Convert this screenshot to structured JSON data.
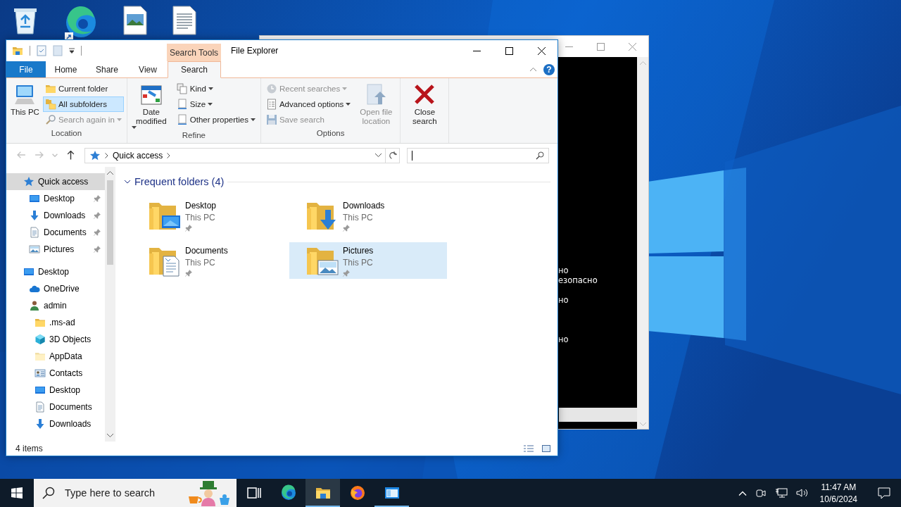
{
  "console_window": {
    "lines": [
      "но",
      "езопасно",
      "но",
      "но"
    ]
  },
  "explorer": {
    "title": "File Explorer",
    "contextual_tab_group": "Search Tools",
    "help_button": "?",
    "ribbon_tabs": [
      {
        "label": "File",
        "kind": "file",
        "selected": false
      },
      {
        "label": "Home",
        "kind": "tab",
        "selected": false
      },
      {
        "label": "Share",
        "kind": "tab",
        "selected": false
      },
      {
        "label": "View",
        "kind": "tab",
        "selected": false
      },
      {
        "label": "Search",
        "kind": "tab",
        "selected": true
      }
    ],
    "ribbon_groups": [
      {
        "label": "Location",
        "blocks": [
          {
            "kind": "large",
            "buttons": [
              {
                "label": "This PC",
                "kind": "pc",
                "selected": false,
                "disabled": false,
                "dropdown": false
              }
            ]
          },
          {
            "kind": "column",
            "buttons": [
              {
                "label": "Current folder",
                "kind": "folder",
                "selected": false,
                "disabled": false,
                "dropdown": false
              },
              {
                "label": "All subfolders",
                "kind": "subfolders",
                "selected": true,
                "disabled": false,
                "dropdown": false
              },
              {
                "label": "Search again in",
                "kind": "searchagain",
                "selected": false,
                "disabled": true,
                "dropdown": true
              }
            ]
          }
        ]
      },
      {
        "label": "Refine",
        "blocks": [
          {
            "kind": "large",
            "buttons": [
              {
                "label": "Date modified",
                "kind": "calendar",
                "selected": false,
                "disabled": false,
                "dropdown": true
              }
            ]
          },
          {
            "kind": "column",
            "buttons": [
              {
                "label": "Kind",
                "kind": "kind",
                "selected": false,
                "disabled": false,
                "dropdown": true
              },
              {
                "label": "Size",
                "kind": "size",
                "selected": false,
                "disabled": false,
                "dropdown": true
              },
              {
                "label": "Other properties",
                "kind": "properties",
                "selected": false,
                "disabled": false,
                "dropdown": true
              }
            ]
          }
        ]
      },
      {
        "label": "Options",
        "blocks": [
          {
            "kind": "column",
            "buttons": [
              {
                "label": "Recent searches",
                "kind": "recent",
                "selected": false,
                "disabled": true,
                "dropdown": true
              },
              {
                "label": "Advanced options",
                "kind": "advanced",
                "selected": false,
                "disabled": false,
                "dropdown": true
              },
              {
                "label": "Save search",
                "kind": "save",
                "selected": false,
                "disabled": true,
                "dropdown": false
              }
            ]
          },
          {
            "kind": "large",
            "buttons": [
              {
                "label": "Open file location",
                "kind": "openloc",
                "selected": false,
                "disabled": true,
                "dropdown": false
              }
            ]
          }
        ]
      },
      {
        "blocks": [
          {
            "kind": "large",
            "buttons": [
              {
                "label": "Close search",
                "kind": "close",
                "selected": false,
                "disabled": false,
                "dropdown": false
              }
            ]
          }
        ]
      }
    ],
    "nav_buttons": [
      {
        "kind": "back",
        "disabled": true
      },
      {
        "kind": "forward",
        "disabled": true
      },
      {
        "kind": "recent",
        "disabled": true
      },
      {
        "kind": "up",
        "disabled": false
      }
    ],
    "address_bar": {
      "segments": [
        "Quick access"
      ]
    },
    "nav_pane": [
      {
        "label": "Quick access",
        "kind": "star",
        "selected": true,
        "pinned": false,
        "children": [
          {
            "label": "Desktop",
            "kind": "desktop",
            "selected": false,
            "pinned": true
          },
          {
            "label": "Downloads",
            "kind": "downloads",
            "selected": false,
            "pinned": true
          },
          {
            "label": "Documents",
            "kind": "documents",
            "selected": false,
            "pinned": true
          },
          {
            "label": "Pictures",
            "kind": "pictures",
            "selected": false,
            "pinned": true
          }
        ]
      },
      {
        "label": "Desktop",
        "kind": "desktop",
        "selected": false,
        "pinned": false,
        "children": [
          {
            "label": "OneDrive",
            "kind": "onedrive",
            "selected": false,
            "pinned": false
          },
          {
            "label": "admin",
            "kind": "user",
            "selected": false,
            "pinned": false,
            "children": [
              {
                "label": ".ms-ad",
                "kind": "folder",
                "selected": false,
                "pinned": false
              },
              {
                "label": "3D Objects",
                "kind": "cube",
                "selected": false,
                "pinned": false
              },
              {
                "label": "AppData",
                "kind": "folderlight",
                "selected": false,
                "pinned": false
              },
              {
                "label": "Contacts",
                "kind": "contacts",
                "selected": false,
                "pinned": false
              },
              {
                "label": "Desktop",
                "kind": "desktop",
                "selected": false,
                "pinned": false
              },
              {
                "label": "Documents",
                "kind": "documents",
                "selected": false,
                "pinned": false
              },
              {
                "label": "Downloads",
                "kind": "downloads",
                "selected": false,
                "pinned": false
              }
            ]
          }
        ]
      }
    ],
    "content": {
      "groups": [
        {
          "title": "Frequent folders (4)",
          "expanded": true,
          "items": [
            {
              "name": "Desktop",
              "location": "This PC",
              "kind": "desktop",
              "pinned": true,
              "selected": false
            },
            {
              "name": "Downloads",
              "location": "This PC",
              "kind": "downloads",
              "pinned": true,
              "selected": false
            },
            {
              "name": "Documents",
              "location": "This PC",
              "kind": "documents",
              "pinned": true,
              "selected": false
            },
            {
              "name": "Pictures",
              "location": "This PC",
              "kind": "pictures",
              "pinned": true,
              "selected": true
            }
          ]
        }
      ]
    },
    "status_bar": {
      "item_count": "4 items"
    }
  },
  "taskbar": {
    "search_placeholder": "Type here to search",
    "apps": [
      {
        "kind": "taskview",
        "running": false,
        "selected": false
      },
      {
        "kind": "edge",
        "running": false,
        "selected": false
      },
      {
        "kind": "explorer",
        "running": true,
        "selected": true
      },
      {
        "kind": "firefox",
        "running": false,
        "selected": false
      },
      {
        "kind": "appwindow",
        "running": true,
        "selected": false
      }
    ],
    "clock": {
      "time": "11:47 AM",
      "date": "10/6/2024"
    }
  }
}
